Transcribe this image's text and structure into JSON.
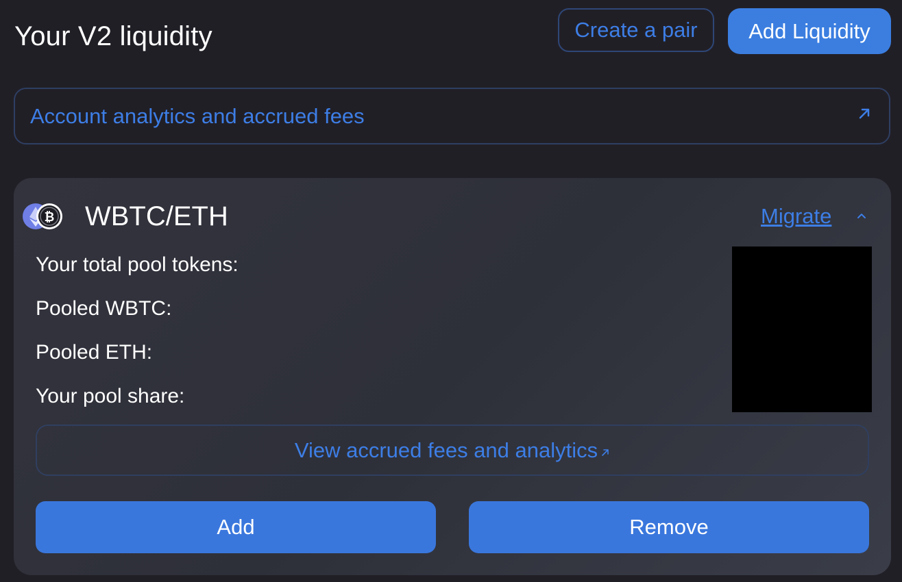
{
  "header": {
    "title": "Your V2 liquidity",
    "create_pair_label": "Create a pair",
    "add_liquidity_label": "Add Liquidity"
  },
  "analytics_link": {
    "label": "Account analytics and accrued fees",
    "icon": "external-arrow-icon"
  },
  "pool": {
    "pair": "WBTC/ETH",
    "token_icons": [
      "eth-token-icon",
      "wbtc-token-icon"
    ],
    "migrate_label": "Migrate",
    "rows": [
      {
        "label": "Your total pool tokens:"
      },
      {
        "label": "Pooled WBTC:"
      },
      {
        "label": "Pooled ETH:"
      },
      {
        "label": "Your pool share:"
      }
    ],
    "view_fees_label": "View accrued fees and analytics",
    "add_label": "Add",
    "remove_label": "Remove"
  },
  "colors": {
    "background": "#211f26",
    "accent": "#3b7ee0",
    "link": "#3d7ee6",
    "card": "#33333d"
  }
}
